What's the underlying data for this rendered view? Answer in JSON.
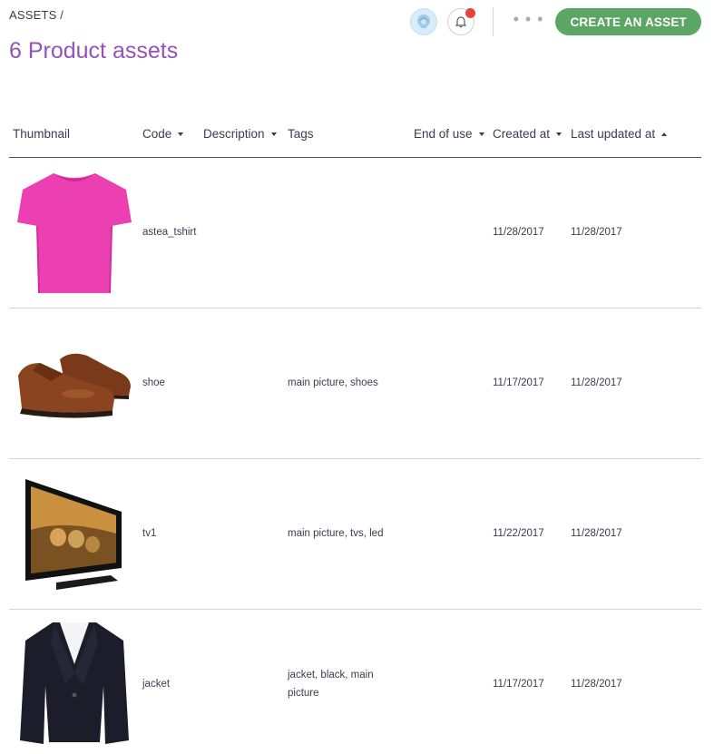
{
  "header": {
    "breadcrumb": "ASSETS /",
    "title": "6 Product assets",
    "more_label": "• • •",
    "create_button": "CREATE AN ASSET"
  },
  "colors": {
    "title": "#9452ba",
    "create_button": "#5ca665",
    "notification_dot": "#e4453a"
  },
  "columns": [
    {
      "label": "Thumbnail",
      "sort": "none"
    },
    {
      "label": "Code",
      "sort": "desc"
    },
    {
      "label": "Description",
      "sort": "desc"
    },
    {
      "label": "Tags",
      "sort": "none"
    },
    {
      "label": "End of use",
      "sort": "desc"
    },
    {
      "label": "Created at",
      "sort": "desc"
    },
    {
      "label": "Last updated at",
      "sort": "asc"
    }
  ],
  "rows": [
    {
      "thumbnail": "pink-tshirt-image",
      "code": "astea_tshirt",
      "description": "",
      "tags": "",
      "end_of_use": "",
      "created_at": "11/28/2017",
      "updated_at": "11/28/2017"
    },
    {
      "thumbnail": "brown-shoes-image",
      "code": "shoe",
      "description": "",
      "tags": "main picture, shoes",
      "end_of_use": "",
      "created_at": "11/17/2017",
      "updated_at": "11/28/2017"
    },
    {
      "thumbnail": "tv-image",
      "code": "tv1",
      "description": "",
      "tags": "main picture, tvs, led",
      "end_of_use": "",
      "created_at": "11/22/2017",
      "updated_at": "11/28/2017"
    },
    {
      "thumbnail": "black-jacket-image",
      "code": "jacket",
      "description": "",
      "tags": "jacket, black, main picture",
      "end_of_use": "",
      "created_at": "11/17/2017",
      "updated_at": "11/28/2017"
    }
  ]
}
